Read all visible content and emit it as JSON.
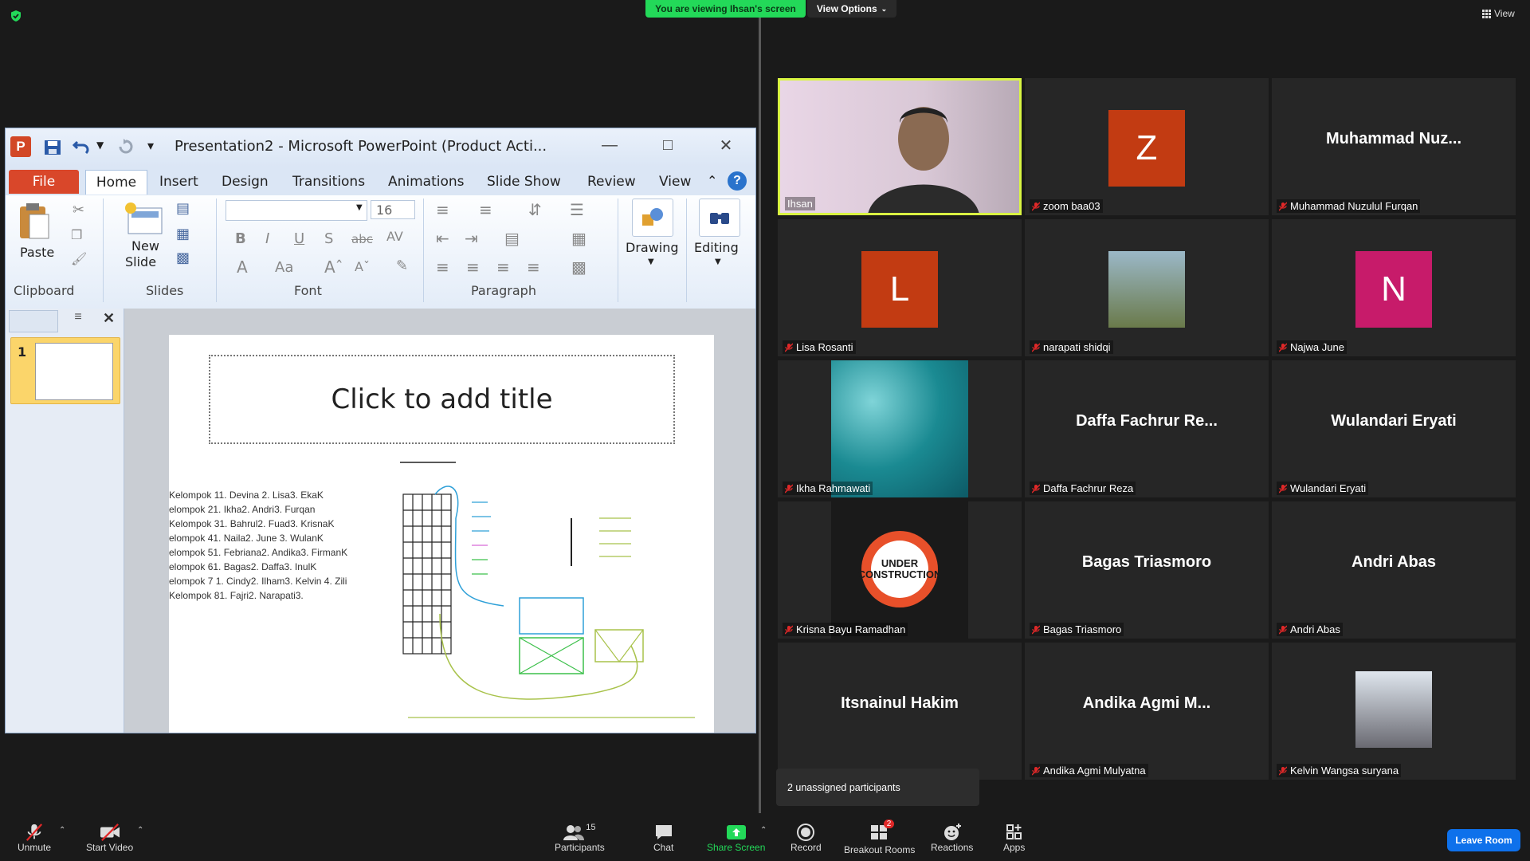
{
  "top_bar": {
    "viewing_banner": "You are viewing Ihsan's screen",
    "view_options": "View Options",
    "view_label": "View"
  },
  "ppt": {
    "window_title": "Presentation2  -  Microsoft PowerPoint (Product Acti...",
    "tabs": [
      "File",
      "Home",
      "Insert",
      "Design",
      "Transitions",
      "Animations",
      "Slide Show",
      "Review",
      "View"
    ],
    "clipboard": {
      "paste": "Paste",
      "group": "Clipboard"
    },
    "slides": {
      "new_slide_line1": "New",
      "new_slide_line2": "Slide",
      "group": "Slides"
    },
    "font": {
      "size": "16",
      "group": "Font"
    },
    "paragraph": {
      "group": "Paragraph"
    },
    "drawing": "Drawing",
    "editing": "Editing",
    "slide_number": "1",
    "slide_title_placeholder": "Click to add title",
    "kelompok_lines": [
      "Kelompok 11. Devina 2. Lisa3. EkaK",
      "elompok 21. Ikha2. Andri3. Furqan",
      "Kelompok 31. Bahrul2. Fuad3. KrisnaK",
      "elompok 41. Naila2. June 3. WulanK",
      "elompok 51. Febriana2. Andika3. FirmanK",
      "elompok 61. Bagas2. Daffa3. InulK",
      "elompok 7 1. Cindy2. Ilham3. Kelvin 4. Zili",
      "Kelompok 81. Fajri2. Narapati3."
    ]
  },
  "participants": [
    {
      "name": "Ihsan",
      "display": "",
      "type": "video"
    },
    {
      "name": "zoom baa03",
      "display": "Z",
      "type": "letter",
      "color": "#c23b12"
    },
    {
      "name": "Muhammad Nuzulul Furqan",
      "display": "Muhammad  Nuz...",
      "type": "text"
    },
    {
      "name": "Lisa Rosanti",
      "display": "L",
      "type": "letter",
      "color": "#c23b12"
    },
    {
      "name": "narapati shidqi",
      "display": "",
      "type": "photo"
    },
    {
      "name": "Najwa June",
      "display": "N",
      "type": "letter",
      "color": "#c71b6a"
    },
    {
      "name": "Ikha Rahmawati",
      "display": "",
      "type": "photo"
    },
    {
      "name": "Daffa Fachrur Reza",
      "display": "Daffa  Fachrur  Re...",
      "type": "text"
    },
    {
      "name": "Wulandari Eryati",
      "display": "Wulandari Eryati",
      "type": "text"
    },
    {
      "name": "Krisna Bayu Ramadhan",
      "display": "UNDER CONSTRUCTION",
      "type": "photo"
    },
    {
      "name": "Bagas Triasmoro",
      "display": "Bagas Triasmoro",
      "type": "text"
    },
    {
      "name": "Andri Abas",
      "display": "Andri Abas",
      "type": "text"
    },
    {
      "name": "",
      "display": "Itsnainul Hakim",
      "type": "text"
    },
    {
      "name": "Andika Agmi Mulyatna",
      "display": "Andika  Agmi  M...",
      "type": "text"
    },
    {
      "name": "Kelvin Wangsa suryana",
      "display": "",
      "type": "photo"
    }
  ],
  "unassigned": "2 unassigned participants",
  "toolbar": {
    "unmute": "Unmute",
    "start_video": "Start Video",
    "participants": "Participants",
    "participants_count": "15",
    "chat": "Chat",
    "share_screen": "Share Screen",
    "record": "Record",
    "breakout_rooms": "Breakout Rooms",
    "breakout_badge": "2",
    "reactions": "Reactions",
    "apps": "Apps",
    "leave_room": "Leave Room"
  },
  "colors": {
    "banner_green": "#23d959",
    "leave_blue": "#0e71eb",
    "active_speaker": "#d9f542",
    "mute_red": "#e02828"
  }
}
